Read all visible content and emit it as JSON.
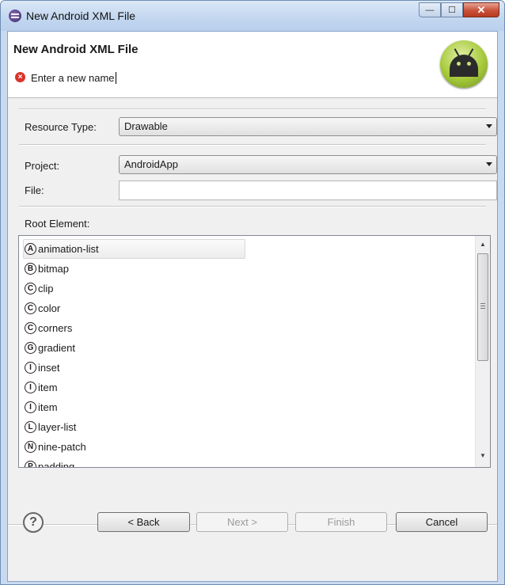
{
  "window": {
    "title": "New Android XML File",
    "controls": {
      "minimize": "—",
      "maximize": "☐",
      "close": "✕"
    }
  },
  "banner": {
    "title": "New Android XML File",
    "error_message": "Enter a new name",
    "error_icon": "error-icon",
    "logo": "android-logo"
  },
  "form": {
    "resource_type_label": "Resource Type:",
    "resource_type_value": "Drawable",
    "project_label": "Project:",
    "project_value": "AndroidApp",
    "file_label": "File:",
    "file_value": "",
    "root_element_label": "Root Element:"
  },
  "root_elements": [
    {
      "letter": "A",
      "name": "animation-list"
    },
    {
      "letter": "B",
      "name": "bitmap"
    },
    {
      "letter": "C",
      "name": "clip"
    },
    {
      "letter": "C",
      "name": "color"
    },
    {
      "letter": "C",
      "name": "corners"
    },
    {
      "letter": "G",
      "name": "gradient"
    },
    {
      "letter": "I",
      "name": "inset"
    },
    {
      "letter": "I",
      "name": "item"
    },
    {
      "letter": "I",
      "name": "item"
    },
    {
      "letter": "L",
      "name": "layer-list"
    },
    {
      "letter": "N",
      "name": "nine-patch"
    },
    {
      "letter": "P",
      "name": "padding"
    }
  ],
  "selected_root_element": "animation-list",
  "buttons": {
    "help": "?",
    "back": "< Back",
    "next": "Next >",
    "finish": "Finish",
    "cancel": "Cancel"
  },
  "colors": {
    "error": "#d9342b",
    "android_green": "#a6c93a",
    "window_frame": "#c9daf0"
  }
}
